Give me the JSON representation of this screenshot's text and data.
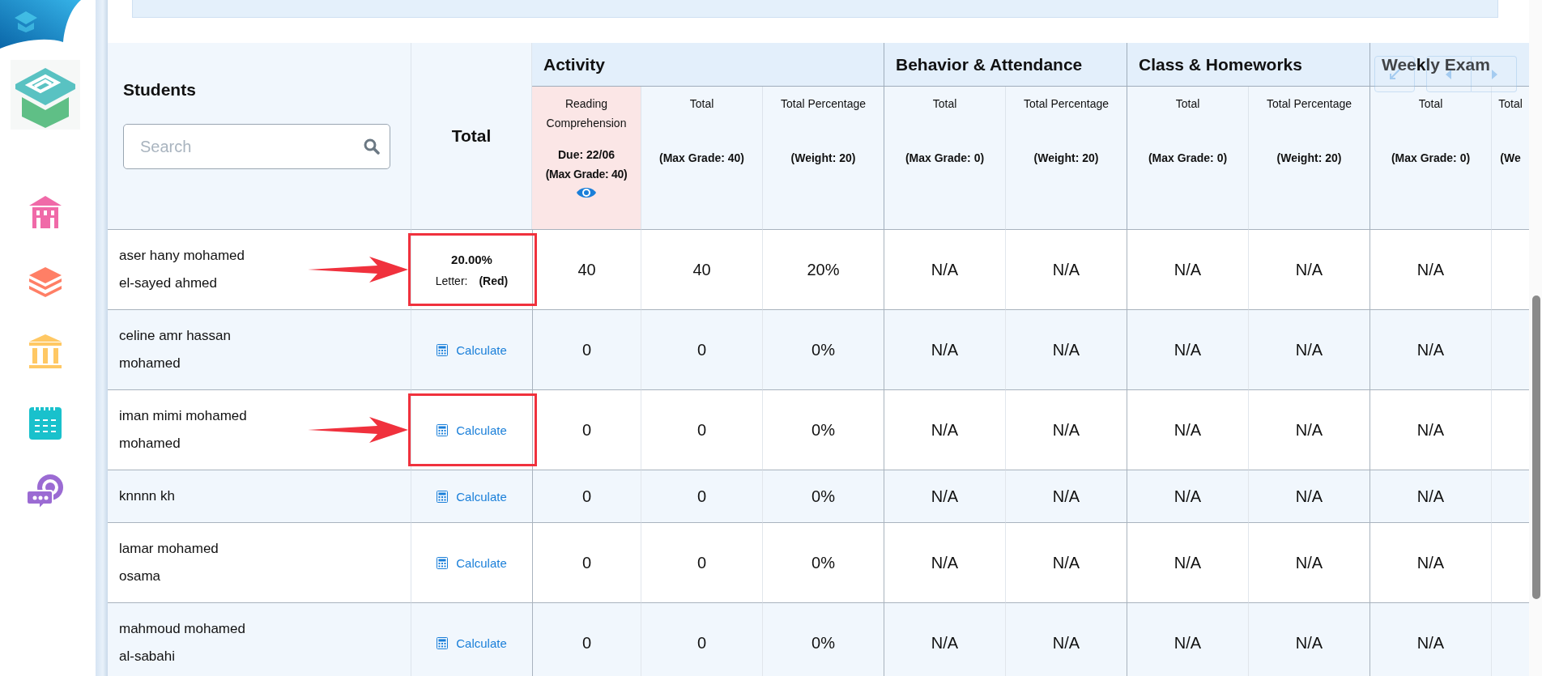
{
  "students_header": {
    "title": "Students",
    "search": {
      "placeholder": "Search"
    }
  },
  "total_header": "Total",
  "groups": [
    {
      "title": "Activity",
      "columns": [
        {
          "kind": "assignment",
          "title": "Reading Comprehension",
          "due": "Due: 22/06",
          "detail": "(Max Grade: 40)"
        },
        {
          "kind": "summary",
          "title": "Total",
          "detail": "(Max Grade: 40)"
        },
        {
          "kind": "summary",
          "title": "Total Percentage",
          "detail": "(Weight: 20)"
        }
      ]
    },
    {
      "title": "Behavior & Attendance",
      "columns": [
        {
          "kind": "summary",
          "title": "Total",
          "detail": "(Max Grade: 0)"
        },
        {
          "kind": "summary",
          "title": "Total Percentage",
          "detail": "(Weight: 20)"
        }
      ]
    },
    {
      "title": "Class & Homeworks",
      "columns": [
        {
          "kind": "summary",
          "title": "Total",
          "detail": "(Max Grade: 0)"
        },
        {
          "kind": "summary",
          "title": "Total Percentage",
          "detail": "(Weight: 20)"
        }
      ]
    },
    {
      "title": "Weekly Exam",
      "columns": [
        {
          "kind": "summary",
          "title": "Total",
          "detail": "(Max Grade: 0)"
        },
        {
          "kind": "summary",
          "title": "Total",
          "detail": "(We"
        }
      ]
    }
  ],
  "rows": [
    {
      "name": "aser hany mohamed\nel-sayed ahmed",
      "highlighted": true,
      "total": {
        "kind": "grade",
        "percent": "20.00%",
        "letter_label": "Letter:",
        "letter": "(Red)"
      },
      "cells": [
        "40",
        "40",
        "20%",
        "N/A",
        "N/A",
        "N/A",
        "N/A",
        "N/A"
      ]
    },
    {
      "name": "celine amr hassan\nmohamed",
      "highlighted": false,
      "total": {
        "kind": "calculate",
        "label": "Calculate"
      },
      "cells": [
        "0",
        "0",
        "0%",
        "N/A",
        "N/A",
        "N/A",
        "N/A",
        "N/A"
      ]
    },
    {
      "name": "iman mimi mohamed\nmohamed",
      "highlighted": true,
      "total": {
        "kind": "calculate",
        "label": "Calculate"
      },
      "cells": [
        "0",
        "0",
        "0%",
        "N/A",
        "N/A",
        "N/A",
        "N/A",
        "N/A"
      ]
    },
    {
      "name": "knnnn kh",
      "highlighted": false,
      "total": {
        "kind": "calculate",
        "label": "Calculate"
      },
      "cells": [
        "0",
        "0",
        "0%",
        "N/A",
        "N/A",
        "N/A",
        "N/A",
        "N/A"
      ]
    },
    {
      "name": "lamar mohamed\nosama",
      "highlighted": false,
      "total": {
        "kind": "calculate",
        "label": "Calculate"
      },
      "cells": [
        "0",
        "0",
        "0%",
        "N/A",
        "N/A",
        "N/A",
        "N/A",
        "N/A"
      ]
    },
    {
      "name": "mahmoud mohamed\nal-sabahi",
      "highlighted": false,
      "total": {
        "kind": "calculate",
        "label": "Calculate"
      },
      "cells": [
        "0",
        "0",
        "0%",
        "N/A",
        "N/A",
        "N/A",
        "N/A",
        "N/A"
      ]
    }
  ]
}
